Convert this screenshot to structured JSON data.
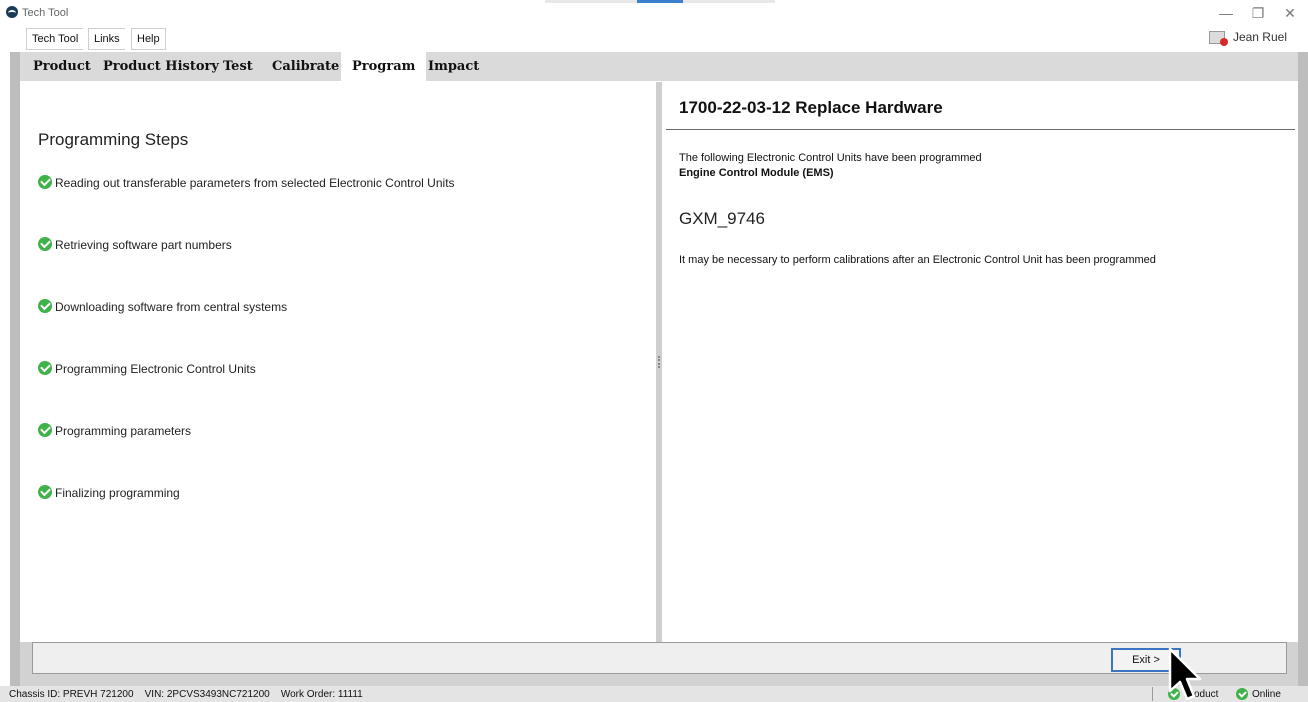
{
  "window": {
    "title": "Tech Tool",
    "minimize": "—",
    "restore": "❐",
    "close": "✕"
  },
  "menu": {
    "items": [
      "Tech Tool",
      "Links",
      "Help"
    ],
    "user": "Jean Ruel"
  },
  "tabs": [
    {
      "label": "Product",
      "active": false
    },
    {
      "label": "Product History",
      "active": false
    },
    {
      "label": "Test",
      "active": false
    },
    {
      "label": "Calibrate",
      "active": false
    },
    {
      "label": "Program",
      "active": true
    },
    {
      "label": "Impact",
      "active": false
    }
  ],
  "steps": {
    "title": "Programming Steps",
    "items": [
      "Reading out transferable parameters from selected Electronic Control Units",
      "Retrieving software part numbers",
      "Downloading software from central systems",
      "Programming Electronic Control Units",
      "Programming parameters",
      "Finalizing programming"
    ]
  },
  "result": {
    "heading": "1700-22-03-12 Replace Hardware",
    "intro": "The following Electronic Control Units have been programmed",
    "ecu": "Engine Control Module (EMS)",
    "part_number": "GXM_9746",
    "note": "It may be necessary to perform calibrations after an Electronic Control Unit has been programmed"
  },
  "buttons": {
    "exit": "Exit >"
  },
  "status": {
    "chassis": "Chassis ID: PREVH 721200",
    "vin": "VIN: 2PCVS3493NC721200",
    "work_order": "Work Order: 11111",
    "product": "Product",
    "online": "Online"
  },
  "colors": {
    "check": "#3fb24a",
    "tab_bar": "#dadada",
    "exit_border": "#3c74c4"
  },
  "icons": [
    "app-logo-icon",
    "check-icon",
    "user-icon",
    "cursor-arrow-icon"
  ]
}
